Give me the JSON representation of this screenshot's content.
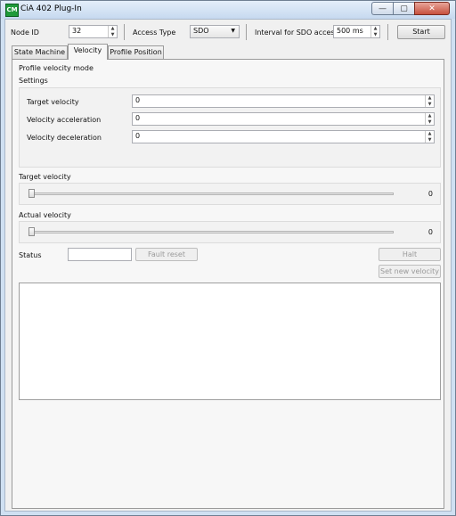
{
  "window": {
    "title": "CiA 402 Plug-In",
    "icon_name": "cia-plugin-icon",
    "icon_text": "CM",
    "minimize_glyph": "—",
    "maximize_glyph": "▢",
    "close_glyph": "✕"
  },
  "toolbar": {
    "node_id_label": "Node ID",
    "node_id_value": "32",
    "access_type_label": "Access Type",
    "access_type_value": "SDO",
    "interval_label": "Interval for SDO access",
    "interval_value": "500 ms",
    "start_label": "Start"
  },
  "tabs": [
    {
      "label": "State Machine",
      "active": false
    },
    {
      "label": "Velocity",
      "active": true
    },
    {
      "label": "Profile Position",
      "active": false
    }
  ],
  "velocity_tab": {
    "mode_title": "Profile velocity mode",
    "settings_title": "Settings",
    "settings": [
      {
        "label": "Target velocity",
        "value": "0"
      },
      {
        "label": "Velocity acceleration",
        "value": "0"
      },
      {
        "label": "Velocity deceleration",
        "value": "0"
      }
    ],
    "target_velocity_section": {
      "label": "Target velocity",
      "value": "0",
      "slider_position": 0
    },
    "actual_velocity_section": {
      "label": "Actual velocity",
      "value": "0",
      "slider_position": 0
    },
    "status_label": "Status",
    "status_value": "",
    "fault_reset_label": "Fault reset",
    "halt_label": "Halt",
    "set_new_velocity_label": "Set new velocity",
    "log_text": ""
  },
  "icons": {
    "spin_up": "▲",
    "spin_down": "▼",
    "dropdown": "▼"
  },
  "colors": {
    "window_frame": "#cfe0f2",
    "client_bg": "#f0f0f0",
    "icon_green": "#1f9a3a"
  }
}
